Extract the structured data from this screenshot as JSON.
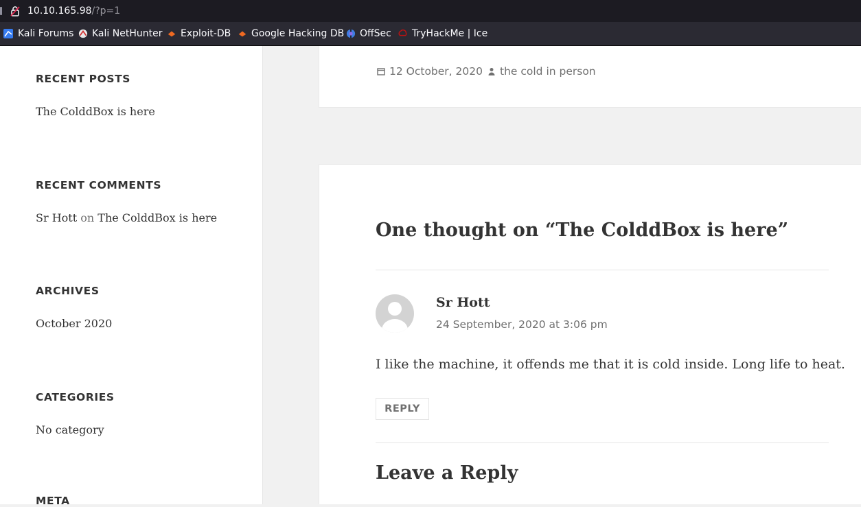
{
  "browser": {
    "url_host": "10.10.165.98",
    "url_path": "/?p=1",
    "bookmarks": [
      {
        "label": "Kali Forums",
        "icon": "kali-icon"
      },
      {
        "label": "Kali NetHunter",
        "icon": "nethunter-icon"
      },
      {
        "label": "Exploit-DB",
        "icon": "exploit-db-icon"
      },
      {
        "label": "Google Hacking DB",
        "icon": "ghdb-icon"
      },
      {
        "label": "OffSec",
        "icon": "offsec-icon"
      },
      {
        "label": "TryHackMe | Ice",
        "icon": "tryhackme-icon"
      }
    ]
  },
  "sidebar": {
    "recent_posts": {
      "title": "RECENT POSTS",
      "items": [
        "The ColddBox is here"
      ]
    },
    "recent_comments": {
      "title": "RECENT COMMENTS",
      "author": "Sr Hott",
      "on": "on",
      "post": "The ColddBox is here"
    },
    "archives": {
      "title": "ARCHIVES",
      "items": [
        "October 2020"
      ]
    },
    "categories": {
      "title": "CATEGORIES",
      "items": [
        "No category"
      ]
    },
    "meta": {
      "title": "META"
    }
  },
  "post_meta": {
    "date": "12 October, 2020",
    "author": "the cold in person"
  },
  "comments": {
    "title": "One thought on “The ColddBox is here”",
    "items": [
      {
        "author": "Sr Hott",
        "date": "24 September, 2020 at 3:06 pm",
        "text": "I like the machine, it offends me that it is cold inside. Long life to heat.",
        "reply_label": "REPLY"
      }
    ],
    "leave_reply": "Leave a Reply"
  },
  "colors": {
    "text": "#333333",
    "muted": "#707070",
    "chrome_dark": "#1c1b22",
    "toolbar": "#2b2a33"
  }
}
